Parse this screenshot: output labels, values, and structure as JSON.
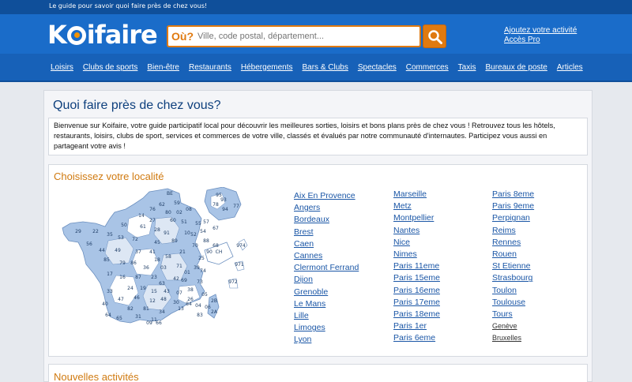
{
  "header": {
    "tagline": "Le guide pour savoir quoi faire près de chez vous!",
    "logo_prefix": "K",
    "logo_suffix": "ifaire",
    "search_prefix": "Où?",
    "search_placeholder": "Ville, code postal, département...",
    "add_activity": "Ajoutez votre activité",
    "pro_access": "Accès Pro",
    "brand_color": "#1a6cc9",
    "accent_color": "#e07a10"
  },
  "nav": [
    "Loisirs",
    "Clubs de sports",
    "Bien-être",
    "Restaurants",
    "Hébergements",
    "Bars & Clubs",
    "Spectacles",
    "Commerces",
    "Taxis",
    "Bureaux de poste",
    "Articles"
  ],
  "main": {
    "title": "Quoi faire près de chez vous?",
    "intro": "Bienvenue sur Koifaire, votre guide participatif local pour découvrir les meilleures sorties, loisirs et bons plans près de chez vous ! Retrouvez tous les hôtels, restaurants, loisirs, clubs de sport, services et commerces de votre ville, classés et évalués par notre communauté d'internautes. Participez vous aussi en partageant votre avis !",
    "locality_title": "Choisissez votre localité",
    "new_title": "Nouvelles activités"
  },
  "map": {
    "labels": [
      "BE",
      "59",
      "62",
      "80",
      "76",
      "02",
      "08",
      "60",
      "14",
      "27",
      "95",
      "78",
      "93",
      "94",
      "77",
      "50",
      "61",
      "28",
      "51",
      "91",
      "10",
      "55",
      "57",
      "67",
      "29",
      "22",
      "35",
      "53",
      "72",
      "45",
      "89",
      "52",
      "54",
      "88",
      "68",
      "56",
      "44",
      "49",
      "37",
      "41",
      "18",
      "58",
      "21",
      "70",
      "90",
      "25",
      "CH",
      "85",
      "79",
      "86",
      "36",
      "03",
      "71",
      "39",
      "01",
      "74",
      "17",
      "16",
      "87",
      "23",
      "63",
      "42",
      "69",
      "73",
      "38",
      "24",
      "19",
      "15",
      "43",
      "07",
      "26",
      "05",
      "33",
      "47",
      "46",
      "12",
      "48",
      "30",
      "84",
      "04",
      "06",
      "40",
      "82",
      "81",
      "34",
      "13",
      "83",
      "64",
      "65",
      "31",
      "11",
      "09",
      "66",
      "2B",
      "2A",
      "974",
      "971",
      "972"
    ]
  },
  "cities": {
    "col1": [
      "Aix En Provence",
      "Angers",
      "Bordeaux",
      "Brest",
      "Caen",
      "Cannes",
      "Clermont Ferrand",
      "Dijon",
      "Grenoble",
      "Le Mans",
      "Lille",
      "Limoges",
      "Lyon"
    ],
    "col2": [
      "Marseille",
      "Metz",
      "Montpellier",
      "Nantes",
      "Nice",
      "Nimes",
      "Paris 11eme",
      "Paris 15eme",
      "Paris 16eme",
      "Paris 17eme",
      "Paris 18eme",
      "Paris 1er",
      "Paris 6eme"
    ],
    "col3": [
      "Paris 8eme",
      "Paris 9eme",
      "Perpignan",
      "Reims",
      "Rennes",
      "Rouen",
      "St Etienne",
      "Strasbourg",
      "Toulon",
      "Toulouse",
      "Tours",
      "Genève",
      "Bruxelles"
    ]
  }
}
